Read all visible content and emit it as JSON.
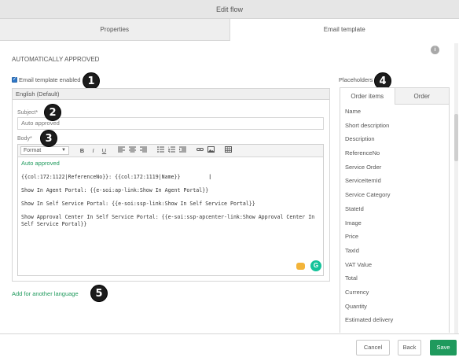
{
  "window": {
    "title": "Edit flow"
  },
  "tabs": [
    {
      "label": "Properties"
    },
    {
      "label": "Email template"
    }
  ],
  "section": {
    "title": "AUTOMATICALLY APPROVED"
  },
  "email_enabled": {
    "label": "Email template enabled",
    "checked": true
  },
  "badges": [
    "1",
    "2",
    "3",
    "4",
    "5"
  ],
  "language": {
    "header": "English (Default)"
  },
  "subject": {
    "label": "Subject*",
    "value": "Auto approved"
  },
  "body": {
    "label": "Body*",
    "format_label": "Format",
    "toolbar": [
      "B",
      "I",
      "U"
    ],
    "green_text": "Auto approved",
    "lines": [
      "{{col:172:1122|ReferenceNo}}: {{col:172:1119|Name}}",
      "Show In Agent Portal: {{e-soi:ap-link:Show In Agent Portal}}",
      "Show In Self Service Portal: {{e-soi:ssp-link:Show In Self Service Portal}}",
      "Show Approval Center In Self Service Portal: {{e-soi:ssp-apcenter-link:Show Approval Center In Self Service Portal}}"
    ]
  },
  "add_language": {
    "label": "Add for another language"
  },
  "placeholders": {
    "title": "Placeholders",
    "tabs": [
      "Order items",
      "Order"
    ],
    "items": [
      "Name",
      "Short description",
      "Description",
      "ReferenceNo",
      "Service Order",
      "ServiceItemId",
      "Service Category",
      "StateId",
      "Image",
      "Price",
      "TaxId",
      "VAT Value",
      "Total",
      "Currency",
      "Quantity",
      "Estimated delivery"
    ]
  },
  "footer": {
    "cancel": "Cancel",
    "back": "Back",
    "save": "Save"
  },
  "colors": {
    "accent": "#1f9a5d",
    "checkbox": "#2f77c6"
  }
}
